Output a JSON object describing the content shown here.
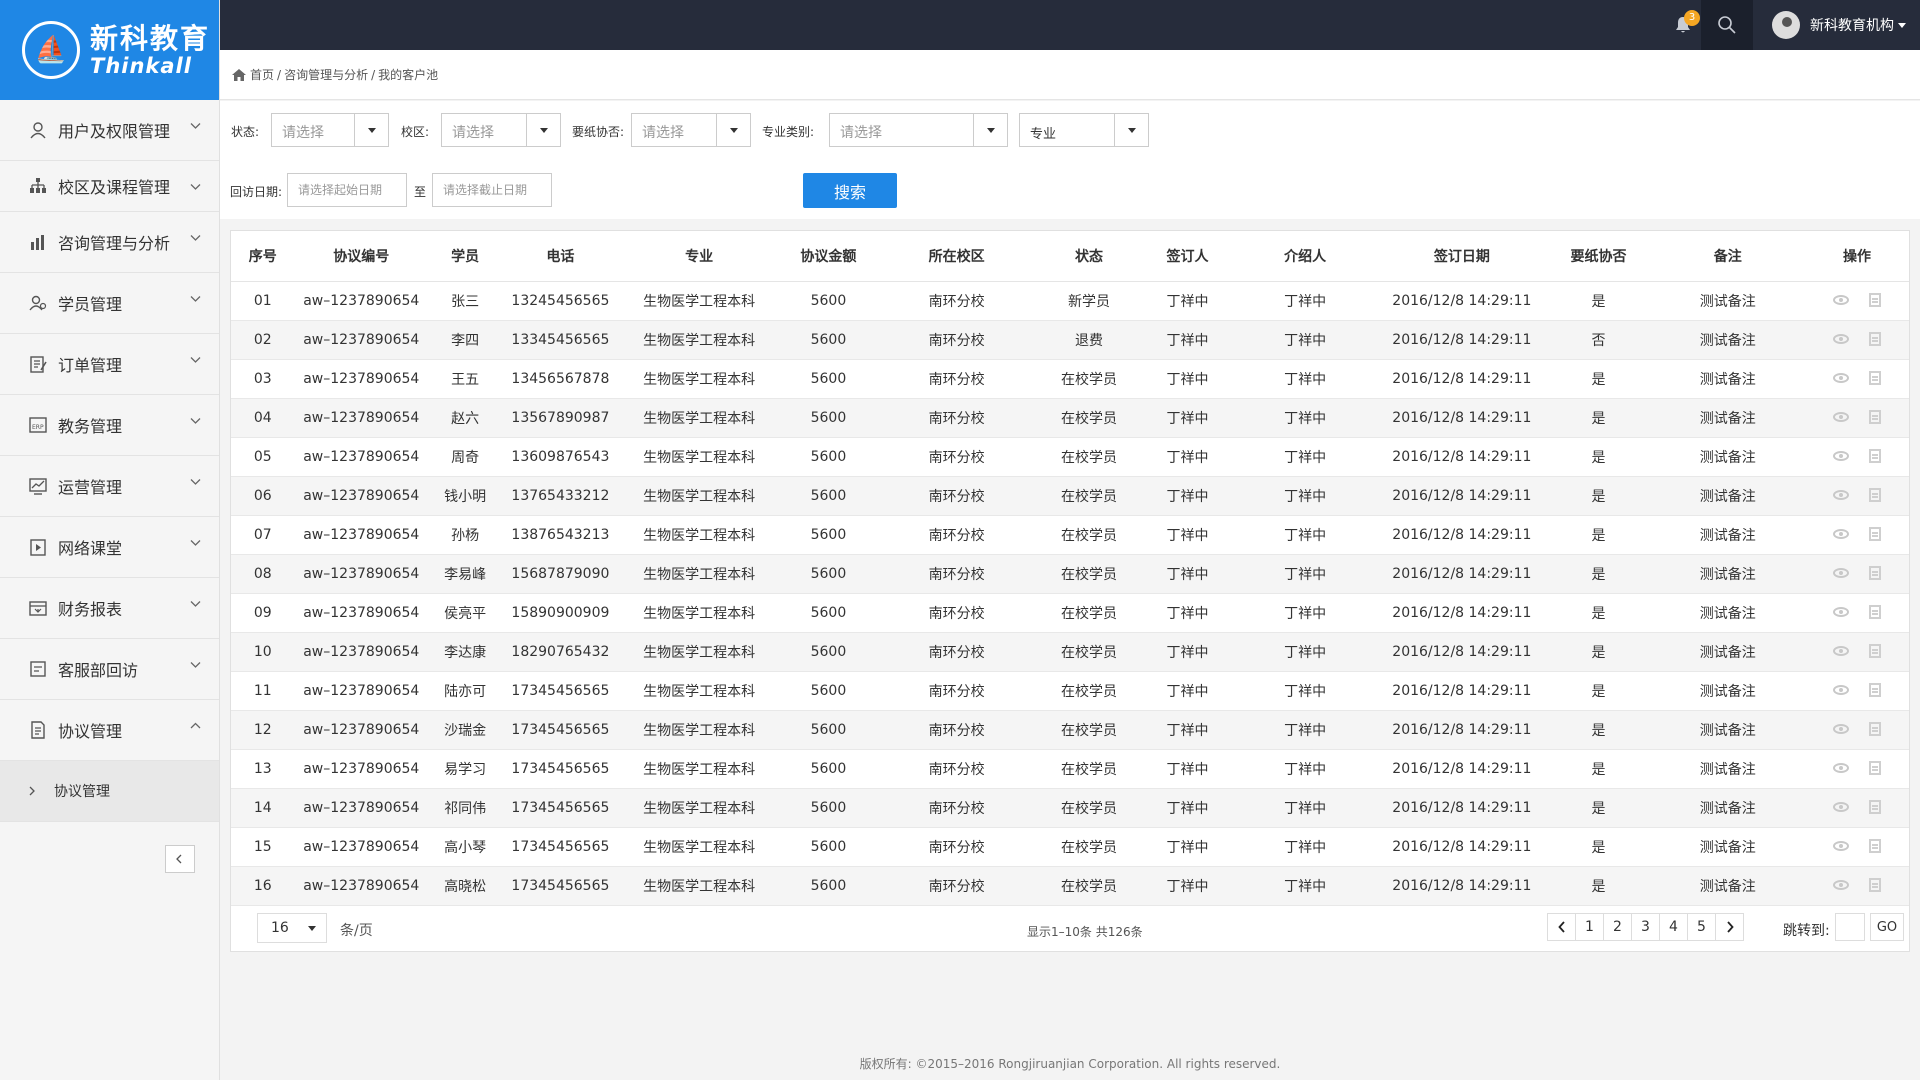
{
  "logo": {
    "cn": "新科教育",
    "en": "Thinkall"
  },
  "sidebar": {
    "items": [
      {
        "label": "用户及权限管理",
        "icon": "user-icon"
      },
      {
        "label": "校区及课程管理",
        "icon": "org-chart-icon"
      },
      {
        "label": "咨询管理与分析",
        "icon": "bar-chart-icon"
      },
      {
        "label": "学员管理",
        "icon": "students-icon"
      },
      {
        "label": "订单管理",
        "icon": "order-icon"
      },
      {
        "label": "教务管理",
        "icon": "erp-icon"
      },
      {
        "label": "运营管理",
        "icon": "trend-icon"
      },
      {
        "label": "网络课堂",
        "icon": "video-icon"
      },
      {
        "label": "财务报表",
        "icon": "finance-icon"
      },
      {
        "label": "客服部回访",
        "icon": "callback-icon"
      },
      {
        "label": "协议管理",
        "icon": "document-icon",
        "expanded": true
      }
    ],
    "sub_item": "协议管理"
  },
  "topbar": {
    "notification_count": "3",
    "user_name": "新科教育机构"
  },
  "breadcrumb": [
    "首页",
    "咨询管理与分析",
    "我的客户池"
  ],
  "filters": {
    "status_label": "状态:",
    "campus_label": "校区:",
    "paper_label": "要纸协否:",
    "major_type_label": "专业类别:",
    "select_placeholder": "请选择",
    "major_value": "专业",
    "visit_date_label": "回访日期:",
    "start_placeholder": "请选择起始日期",
    "to_label": "至",
    "end_placeholder": "请选择截止日期",
    "search_label": "搜索"
  },
  "table": {
    "headers": [
      "序号",
      "协议编号",
      "学员",
      "电话",
      "专业",
      "协议金额",
      "所在校区",
      "状态",
      "签订人",
      "介绍人",
      "签订日期",
      "要纸协否",
      "备注",
      "操作"
    ],
    "rows": [
      [
        "01",
        "aw–1237890654",
        "张三",
        "13245456565",
        "生物医学工程本科",
        "5600",
        "南环分校",
        "新学员",
        "丁祥中",
        "丁祥中",
        "2016/12/8 14:29:11",
        "是",
        "测试备注"
      ],
      [
        "02",
        "aw–1237890654",
        "李四",
        "13345456565",
        "生物医学工程本科",
        "5600",
        "南环分校",
        "退费",
        "丁祥中",
        "丁祥中",
        "2016/12/8 14:29:11",
        "否",
        "测试备注"
      ],
      [
        "03",
        "aw–1237890654",
        "王五",
        "13456567878",
        "生物医学工程本科",
        "5600",
        "南环分校",
        "在校学员",
        "丁祥中",
        "丁祥中",
        "2016/12/8 14:29:11",
        "是",
        "测试备注"
      ],
      [
        "04",
        "aw–1237890654",
        "赵六",
        "13567890987",
        "生物医学工程本科",
        "5600",
        "南环分校",
        "在校学员",
        "丁祥中",
        "丁祥中",
        "2016/12/8 14:29:11",
        "是",
        "测试备注"
      ],
      [
        "05",
        "aw–1237890654",
        "周奇",
        "13609876543",
        "生物医学工程本科",
        "5600",
        "南环分校",
        "在校学员",
        "丁祥中",
        "丁祥中",
        "2016/12/8 14:29:11",
        "是",
        "测试备注"
      ],
      [
        "06",
        "aw–1237890654",
        "钱小明",
        "13765433212",
        "生物医学工程本科",
        "5600",
        "南环分校",
        "在校学员",
        "丁祥中",
        "丁祥中",
        "2016/12/8 14:29:11",
        "是",
        "测试备注"
      ],
      [
        "07",
        "aw–1237890654",
        "孙杨",
        "13876543213",
        "生物医学工程本科",
        "5600",
        "南环分校",
        "在校学员",
        "丁祥中",
        "丁祥中",
        "2016/12/8 14:29:11",
        "是",
        "测试备注"
      ],
      [
        "08",
        "aw–1237890654",
        "李易峰",
        "15687879090",
        "生物医学工程本科",
        "5600",
        "南环分校",
        "在校学员",
        "丁祥中",
        "丁祥中",
        "2016/12/8 14:29:11",
        "是",
        "测试备注"
      ],
      [
        "09",
        "aw–1237890654",
        "侯亮平",
        "15890900909",
        "生物医学工程本科",
        "5600",
        "南环分校",
        "在校学员",
        "丁祥中",
        "丁祥中",
        "2016/12/8 14:29:11",
        "是",
        "测试备注"
      ],
      [
        "10",
        "aw–1237890654",
        "李达康",
        "18290765432",
        "生物医学工程本科",
        "5600",
        "南环分校",
        "在校学员",
        "丁祥中",
        "丁祥中",
        "2016/12/8 14:29:11",
        "是",
        "测试备注"
      ],
      [
        "11",
        "aw–1237890654",
        "陆亦可",
        "17345456565",
        "生物医学工程本科",
        "5600",
        "南环分校",
        "在校学员",
        "丁祥中",
        "丁祥中",
        "2016/12/8 14:29:11",
        "是",
        "测试备注"
      ],
      [
        "12",
        "aw–1237890654",
        "沙瑞金",
        "17345456565",
        "生物医学工程本科",
        "5600",
        "南环分校",
        "在校学员",
        "丁祥中",
        "丁祥中",
        "2016/12/8 14:29:11",
        "是",
        "测试备注"
      ],
      [
        "13",
        "aw–1237890654",
        "易学习",
        "17345456565",
        "生物医学工程本科",
        "5600",
        "南环分校",
        "在校学员",
        "丁祥中",
        "丁祥中",
        "2016/12/8 14:29:11",
        "是",
        "测试备注"
      ],
      [
        "14",
        "aw–1237890654",
        "祁同伟",
        "17345456565",
        "生物医学工程本科",
        "5600",
        "南环分校",
        "在校学员",
        "丁祥中",
        "丁祥中",
        "2016/12/8 14:29:11",
        "是",
        "测试备注"
      ],
      [
        "15",
        "aw–1237890654",
        "高小琴",
        "17345456565",
        "生物医学工程本科",
        "5600",
        "南环分校",
        "在校学员",
        "丁祥中",
        "丁祥中",
        "2016/12/8 14:29:11",
        "是",
        "测试备注"
      ],
      [
        "16",
        "aw–1237890654",
        "高晓松",
        "17345456565",
        "生物医学工程本科",
        "5600",
        "南环分校",
        "在校学员",
        "丁祥中",
        "丁祥中",
        "2016/12/8 14:29:11",
        "是",
        "测试备注"
      ]
    ]
  },
  "pagination": {
    "page_size": "16",
    "per_page_label": "条/页",
    "summary": "显示1–10条  共126条",
    "pages": [
      "1",
      "2",
      "3",
      "4",
      "5"
    ],
    "jump_label": "跳转到:",
    "go_label": "GO"
  },
  "footer": "版权所有: ©2015–2016 Rongjiruanjian Corporation. All rights reserved.",
  "colors": {
    "brand": "#1f87e5",
    "topbar": "#262c3b",
    "badge": "#f5a623"
  }
}
